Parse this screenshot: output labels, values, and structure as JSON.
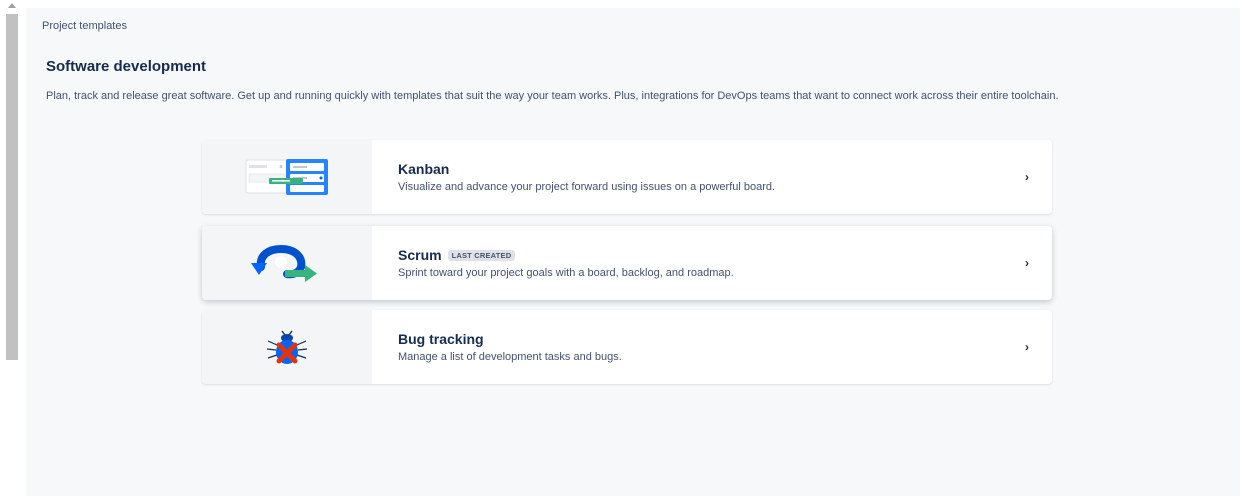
{
  "page": {
    "breadcrumb": "Project templates",
    "heading": "Software development",
    "description": "Plan, track and release great software. Get up and running quickly with templates that suit the way your team works. Plus, integrations for DevOps teams that want to connect work across their entire toolchain."
  },
  "templates": [
    {
      "title": "Kanban",
      "badge": "",
      "description": "Visualize and advance your project forward using issues on a powerful board.",
      "icon": "kanban-board-icon"
    },
    {
      "title": "Scrum",
      "badge": "LAST CREATED",
      "description": "Sprint toward your project goals with a board, backlog, and roadmap.",
      "icon": "scrum-cycle-icon"
    },
    {
      "title": "Bug tracking",
      "badge": "",
      "description": "Manage a list of development tasks and bugs.",
      "icon": "bug-icon"
    }
  ],
  "chevron": "›",
  "colors": {
    "accent_blue": "#0065ff",
    "accent_green": "#36b37e",
    "bug_red": "#de350b",
    "panel_bg": "#f7f8f9",
    "text_primary": "#172b4d",
    "text_secondary": "#42526e"
  }
}
